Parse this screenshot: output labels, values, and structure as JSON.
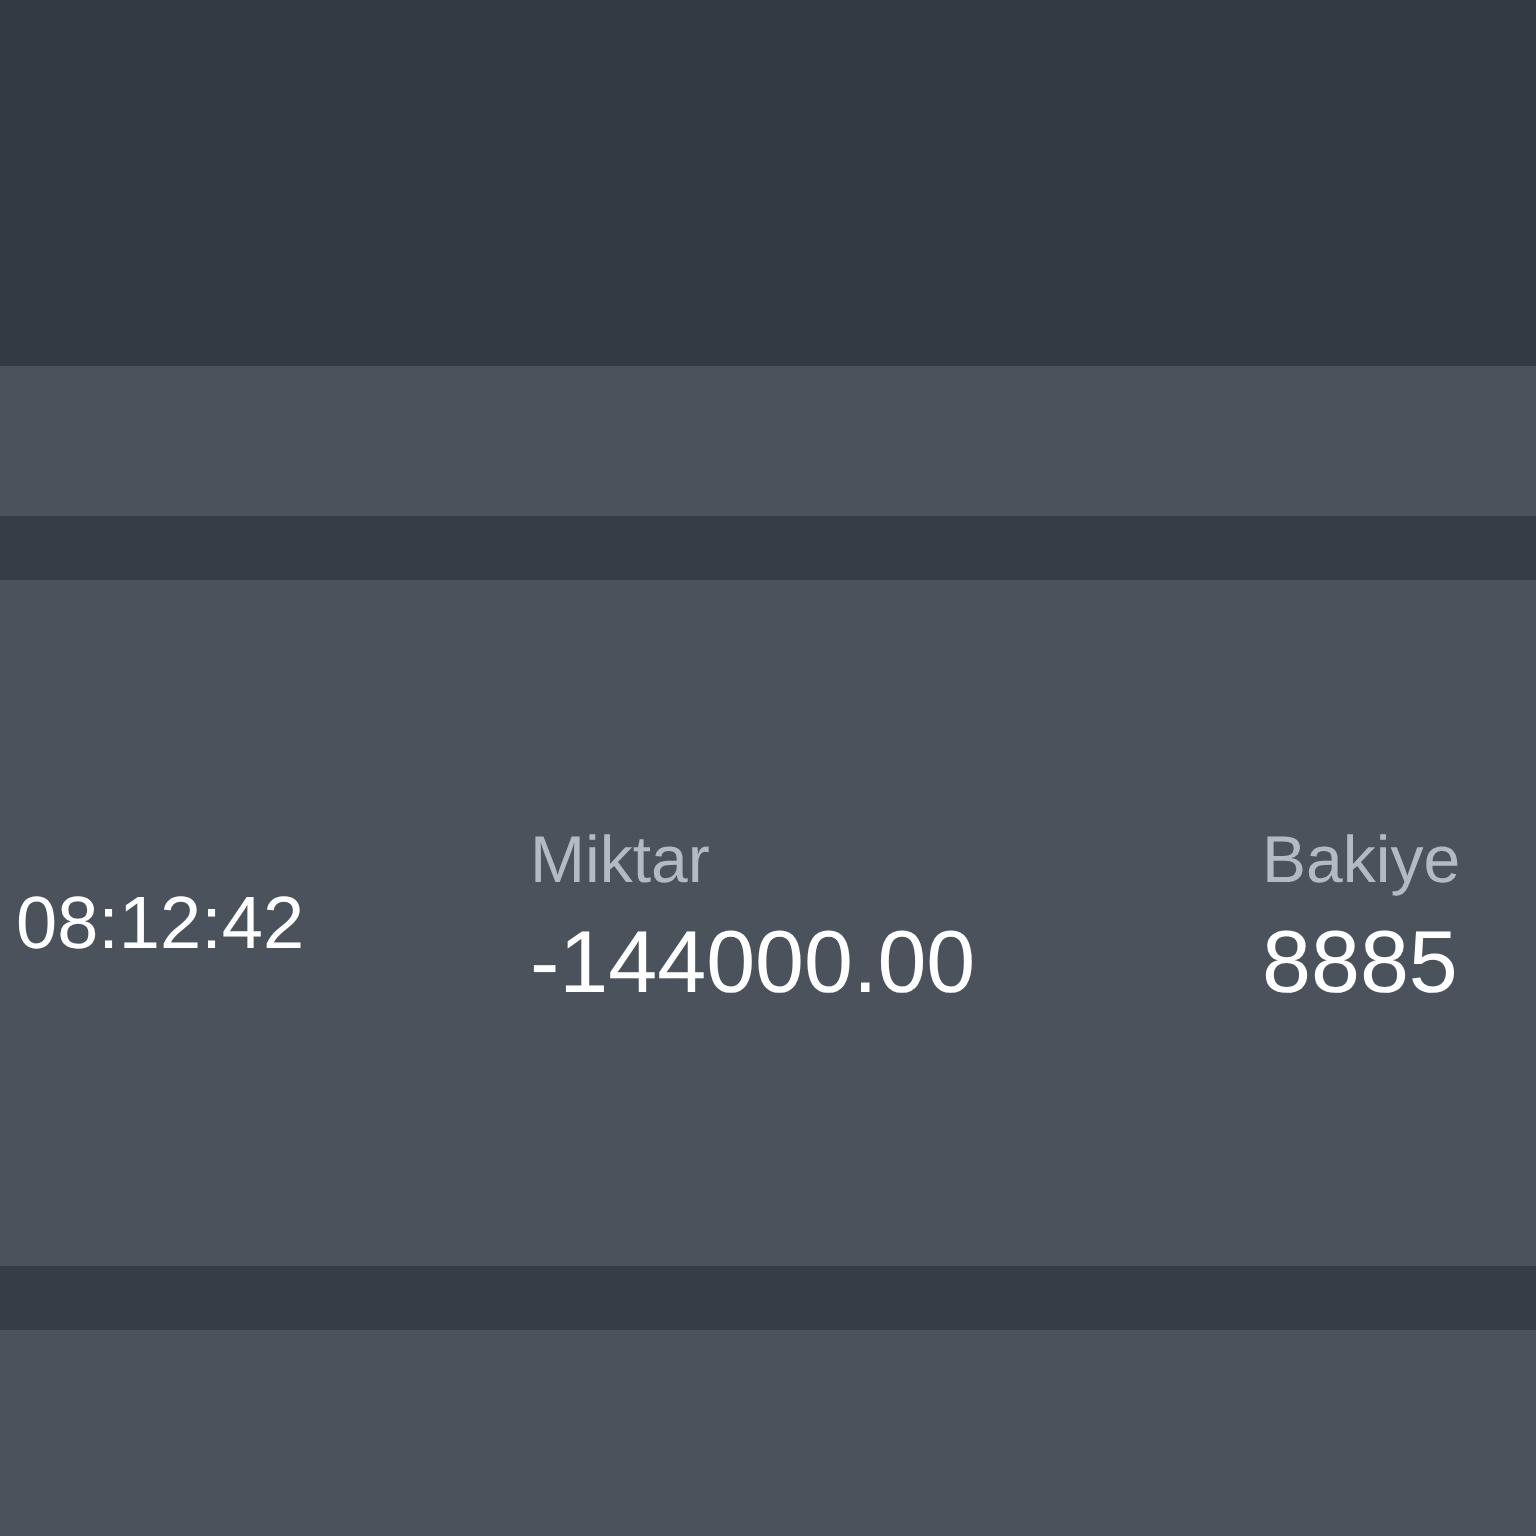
{
  "transaction": {
    "time": "08:12:42",
    "fields": [
      {
        "label": "Miktar",
        "value": "-144000.00"
      },
      {
        "label": "Bakiye",
        "value": "8885"
      }
    ]
  }
}
